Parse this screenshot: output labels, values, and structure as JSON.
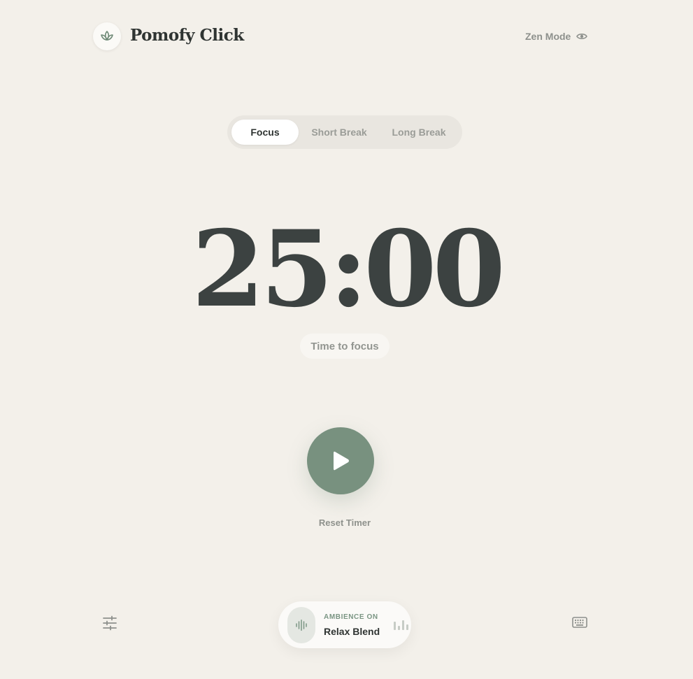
{
  "header": {
    "app_title": "Pomofy Click",
    "logo_icon": "lotus-icon",
    "zen_mode_label": "Zen Mode",
    "zen_mode_icon": "eye-icon"
  },
  "tabs": [
    {
      "label": "Focus",
      "active": true
    },
    {
      "label": "Short Break",
      "active": false
    },
    {
      "label": "Long Break",
      "active": false
    }
  ],
  "timer": {
    "display": "25:00",
    "status": "Time to focus"
  },
  "controls": {
    "play_icon": "play-icon",
    "reset_label": "Reset Timer"
  },
  "ambience": {
    "label": "AMBIENCE ON",
    "name": "Relax Blend",
    "icon": "waveform-icon",
    "bars_icon": "equalizer-icon"
  },
  "footer": {
    "settings_icon": "sliders-icon",
    "keyboard_icon": "keyboard-icon"
  },
  "colors": {
    "background": "#f3f0ea",
    "accent": "#78917f",
    "text_dark": "#3c4241",
    "text_muted": "#8d908c"
  }
}
